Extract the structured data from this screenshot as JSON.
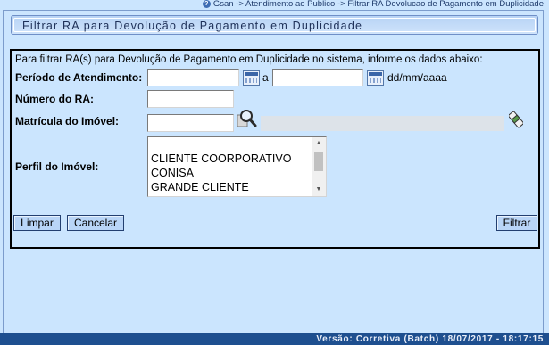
{
  "breadcrumb": {
    "text": "Gsan -> Atendimento ao Publico -> Filtrar RA Devolucao de Pagamento em Duplicidade"
  },
  "title": "Filtrar RA para Devolução de Pagamento em Duplicidade",
  "form": {
    "intro": "Para filtrar RA(s) para Devolução de Pagamento em Duplicidade no sistema, informe os dados abaixo:",
    "periodo_label": "Período de Atendimento:",
    "periodo_inicio": "",
    "periodo_separador": "a",
    "periodo_fim": "",
    "date_format": "dd/mm/aaaa",
    "numero_ra_label": "Número do RA:",
    "numero_ra_value": "",
    "matricula_label": "Matrícula do Imóvel:",
    "matricula_value": "",
    "matricula_descricao": "",
    "perfil_label": "Perfil do Imóvel:",
    "perfil_options": [
      "",
      "CLIENTE COORPORATIVO",
      "CONISA",
      "GRANDE CLIENTE"
    ]
  },
  "buttons": {
    "limpar": "Limpar",
    "cancelar": "Cancelar",
    "filtrar": "Filtrar"
  },
  "icons": {
    "calendar": "calendar-icon",
    "search": "magnifier-icon",
    "clear": "eraser-icon"
  },
  "footer": {
    "version": "Versão: Corretiva (Batch) 18/07/2017 - 18:17:15"
  },
  "colors": {
    "background": "#cbe5fe",
    "footer": "#1e4f8f",
    "button": "#b9d5f7"
  }
}
